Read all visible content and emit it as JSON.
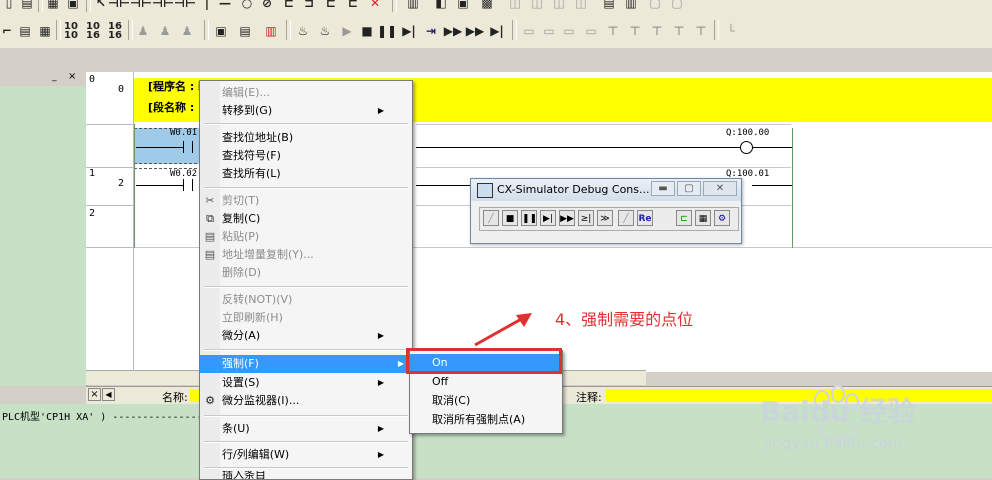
{
  "ladder": {
    "rung0": {
      "line_number": "0",
      "step": "0",
      "program_name_label": "[程序名 : 新程序1",
      "section_name_label": "[段名称 :",
      "contact_address": "W0.01",
      "coil_address": "Q:100.00"
    },
    "rung1": {
      "line_number": "1",
      "step": "2",
      "contact_address": "W0.02",
      "coil_address": "Q:100.01"
    },
    "rung2": {
      "line_number": "2"
    }
  },
  "status": {
    "name_label": "名称:",
    "comment_label": "注释:"
  },
  "output": {
    "line": "PLC机型'CP1H XA' ) -----------------"
  },
  "context_menu": {
    "items": [
      {
        "label": "编辑(E)...",
        "enabled": false
      },
      {
        "label": "转移到(G)",
        "enabled": true,
        "submenu": true
      },
      {
        "label": "查找位地址(B)",
        "enabled": true
      },
      {
        "label": "查找符号(F)",
        "enabled": true
      },
      {
        "label": "查找所有(L)",
        "enabled": true
      },
      {
        "label": "剪切(T)",
        "enabled": false,
        "icon": "scissors-icon"
      },
      {
        "label": "复制(C)",
        "enabled": true,
        "icon": "copy-icon"
      },
      {
        "label": "粘贴(P)",
        "enabled": false,
        "icon": "paste-icon"
      },
      {
        "label": "地址增量复制(Y)...",
        "enabled": false,
        "icon": "increment-copy-icon"
      },
      {
        "label": "删除(D)",
        "enabled": false
      },
      {
        "label": "反转(NOT)(V)",
        "enabled": false
      },
      {
        "label": "立即刷新(H)",
        "enabled": false
      },
      {
        "label": "微分(A)",
        "enabled": true,
        "submenu": true
      },
      {
        "label": "强制(F)",
        "enabled": true,
        "submenu": true,
        "highlighted": true
      },
      {
        "label": "设置(S)",
        "enabled": true,
        "submenu": true
      },
      {
        "label": "微分监视器(I)...",
        "enabled": true,
        "icon": "monitor-icon"
      },
      {
        "label": "条(U)",
        "enabled": true,
        "submenu": true
      },
      {
        "label": "行/列编辑(W)",
        "enabled": true,
        "submenu": true
      },
      {
        "label": "插入条目",
        "enabled": true
      }
    ]
  },
  "force_submenu": {
    "items": [
      {
        "label": "On",
        "highlighted": true
      },
      {
        "label": "Off"
      },
      {
        "label": "取消(C)"
      },
      {
        "label": "取消所有强制点(A)"
      }
    ]
  },
  "simulator": {
    "title": "CX-Simulator Debug Cons...",
    "buttons": [
      "reset-icon",
      "stop-icon",
      "pause-icon",
      "step-run-icon",
      "run-icon",
      "step-icon",
      "continuous-step-icon",
      "scan-replay-icon",
      "reset-scan-icon",
      "io-icon",
      "trace-icon",
      "settings-icon"
    ]
  },
  "annotation": {
    "text": "4、强制需要的点位",
    "color": "#e03030"
  },
  "watermark": {
    "brand": "Baidu 经验",
    "url": "jingyan.baidu.com"
  },
  "colors": {
    "rung_header": "#ffff00",
    "selected_cell": "#9fcbe8",
    "panel_green": "#c7e1c6",
    "menu_highlight": "#3399ff"
  }
}
